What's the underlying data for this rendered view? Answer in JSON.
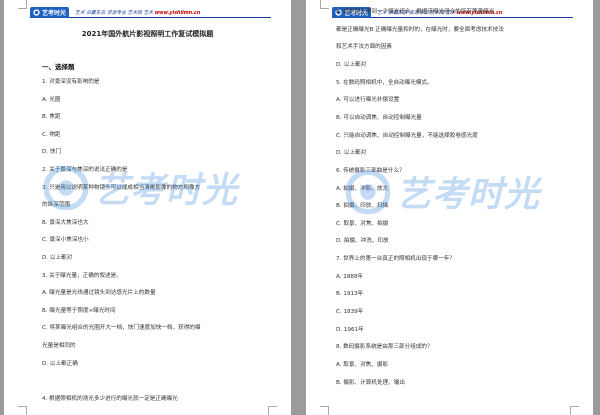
{
  "header": {
    "logo_text": "艺考时光",
    "tagline": "艺术 京藏东京 资源专业 艺术院 艺术",
    "site": "www.yishiimn.cn"
  },
  "watermark": {
    "text": "艺考时光"
  },
  "left_page": {
    "title": "2021年国外航片影视照明工作复试模拟题",
    "section": "一、选择题",
    "lines": [
      "1. 对景深没有影响的是",
      "A. 光圈",
      "B. 焦距",
      "C. 物距",
      "D. 快门",
      "2. 关于景深与焦深的说法正确的是",
      "3. 只是用以说明某种物镜头可以成成相当清晰影像的物方和像方",
      "的纵深范围",
      "B. 景深大焦深也大",
      "C. 景深小焦深也小",
      "D. 以上都对",
      "3. 关于曝光量，正确的叙述是。",
      "A. 曝光量是光线通过镜头到达感光片上的数量",
      "B. 曝光量等于照度×曝光时间",
      "C. 将某曝光组合的光圈开大一档，快门速度加快一档，获得的曝",
      "光量是相同的",
      "D. 以上都正确",
      "",
      "4. 根据照相机的测光多少进行的曝光就一定是正确曝光"
    ]
  },
  "right_page": {
    "lines": [
      "B. 根据测光得到一个曝光组合，根据该曝光组合的所有等量曝光",
      "都是正确曝光B 正确曝光量和时的，在曝光时，要全面考虑技术技法",
      "和艺术手法方面的因素",
      "D. 以上都对",
      "5. 在数码照相机中，全自动曝光模式。",
      "A. 可以进行曝光补偿设置",
      "B. 可以自动调焦、自动控制曝光量",
      "C. 只能自动调焦、自动控制曝光量，不能选择胶卷感光度",
      "D. 以上都对",
      "6. 传统摄影三部曲是什么？",
      "A. 拍摄、冲影、放大",
      "B. 拍摄、印放、扫描",
      "C. 取景、对焦、拍摄",
      "D. 拍摄、冲洗、印放",
      "7. 世界上的第一台真正的照相机出现于哪一年？",
      "A. 1888年",
      "B. 1913年",
      "C. 1839年",
      "D. 1961年",
      "8. 数码摄影系统是由那三部分组成的？",
      "A. 取景、对焦、摄影",
      "B. 摄影、计算机处理、输出"
    ]
  }
}
